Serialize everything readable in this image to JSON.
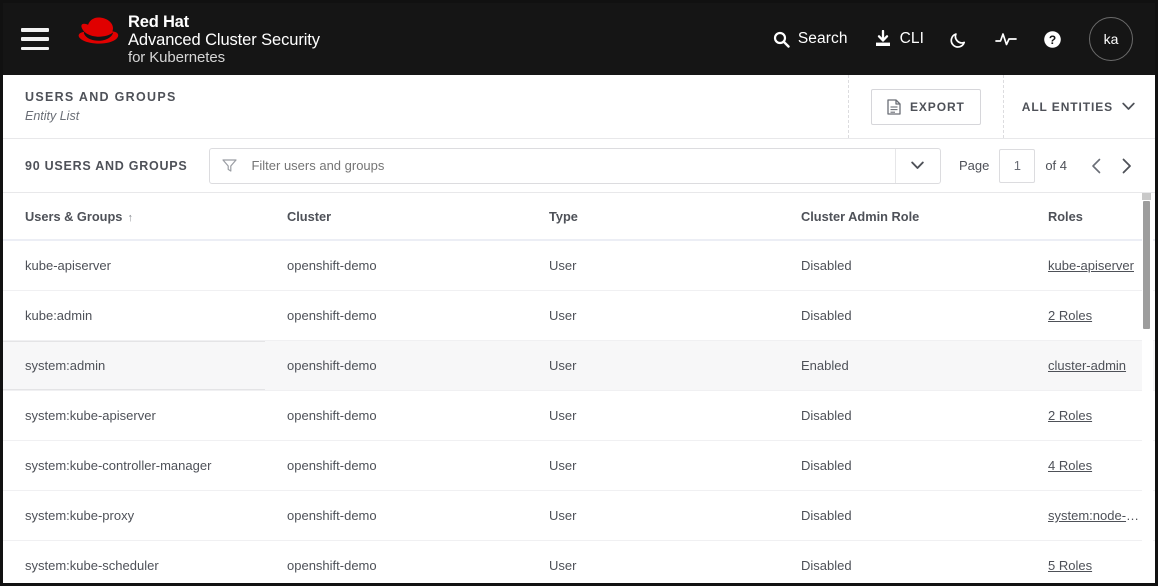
{
  "topnav": {
    "menu_icon": "hamburger-icon",
    "brand": {
      "logo": "red-hat-fedora-logo",
      "company": "Red Hat",
      "product_line1": "Advanced Cluster Security",
      "product_line2": "for Kubernetes"
    },
    "items": [
      {
        "icon": "search-icon",
        "label": "Search"
      },
      {
        "icon": "cli-download-icon",
        "label": "CLI"
      },
      {
        "icon": "moon-icon",
        "label": ""
      },
      {
        "icon": "activity-pulse-icon",
        "label": ""
      },
      {
        "icon": "help-circle-icon",
        "label": ""
      }
    ],
    "avatar_initials": "ka"
  },
  "page_header": {
    "title": "USERS AND GROUPS",
    "subtitle": "Entity List",
    "export_label": "EXPORT",
    "export_icon": "document-export-icon",
    "entities_label": "ALL ENTITIES",
    "entities_icon": "chevron-down-icon"
  },
  "filter_bar": {
    "count_label": "90 USERS AND GROUPS",
    "filter_icon": "funnel-filter-icon",
    "filter_placeholder": "Filter users and groups",
    "filter_value": "",
    "filter_caret_icon": "chevron-down-icon",
    "pager": {
      "page_label": "Page",
      "page_value": "1",
      "of_label": "of 4",
      "prev_icon": "chevron-left-icon",
      "next_icon": "chevron-right-icon"
    }
  },
  "table": {
    "columns": [
      {
        "label": "Users & Groups",
        "sort": "↑"
      },
      {
        "label": "Cluster",
        "sort": ""
      },
      {
        "label": "Type",
        "sort": ""
      },
      {
        "label": "Cluster Admin Role",
        "sort": ""
      },
      {
        "label": "Roles",
        "sort": ""
      }
    ],
    "rows": [
      {
        "name": "kube-apiserver",
        "cluster": "openshift-demo",
        "type": "User",
        "admin_role": "Disabled",
        "roles": "kube-apiserver",
        "hover": false
      },
      {
        "name": "kube:admin",
        "cluster": "openshift-demo",
        "type": "User",
        "admin_role": "Disabled",
        "roles": "2 Roles",
        "hover": false
      },
      {
        "name": "system:admin",
        "cluster": "openshift-demo",
        "type": "User",
        "admin_role": "Enabled",
        "roles": "cluster-admin",
        "hover": true
      },
      {
        "name": "system:kube-apiserver",
        "cluster": "openshift-demo",
        "type": "User",
        "admin_role": "Disabled",
        "roles": "2 Roles",
        "hover": false
      },
      {
        "name": "system:kube-controller-manager",
        "cluster": "openshift-demo",
        "type": "User",
        "admin_role": "Disabled",
        "roles": "4 Roles",
        "hover": false
      },
      {
        "name": "system:kube-proxy",
        "cluster": "openshift-demo",
        "type": "User",
        "admin_role": "Disabled",
        "roles": "system:node-proxier",
        "hover": false
      },
      {
        "name": "system:kube-scheduler",
        "cluster": "openshift-demo",
        "type": "User",
        "admin_role": "Disabled",
        "roles": "5 Roles",
        "hover": false
      }
    ],
    "scrollbar": "vertical-scrollbar"
  },
  "colors": {
    "navbar_bg": "#151515",
    "brand_red": "#e00000",
    "text_primary": "#4e5158",
    "text_muted": "#8a8d93",
    "border": "#e8e8ea",
    "row_hover": "#f7f7f8"
  }
}
